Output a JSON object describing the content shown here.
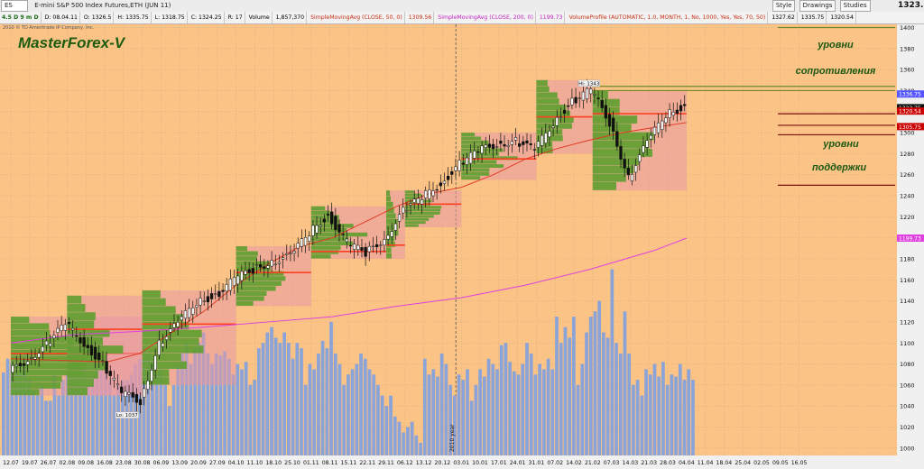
{
  "toolbar": {
    "symbol": "ES",
    "description": "E-mini S&P 500 Index Futures,ETH (JUN 11)",
    "last_price": "1323.75",
    "buttons": [
      {
        "name": "style-button",
        "label": "Style"
      },
      {
        "name": "drawings-button",
        "label": "Drawings"
      },
      {
        "name": "studies-button",
        "label": "Studies"
      }
    ]
  },
  "infobar": {
    "period": "4.5 D 9 m D",
    "date": "D: 08.04.11",
    "open": "O: 1326.5",
    "high": "H: 1335.75",
    "low": "L: 1318.75",
    "close": "C: 1324.25",
    "range": "R: 17",
    "volume_label": "Volume",
    "volume_value": "1,857,370",
    "sma50_label": "SimpleMovingAvg (CLOSE, 50, 0)",
    "sma50_value": "1309.56",
    "sma200_label": "SimpleMovingAvg (CLOSE, 200, 0)",
    "sma200_value": "1199.73",
    "vp_label": "VolumeProfile (AUTOMATIC, 1.0, MONTH, 1, No, 1000, Yes, Yes, 70, 50)",
    "vp_values": [
      "1327.62",
      "1335.75",
      "1320.54"
    ]
  },
  "copyright": "2010 © TD Ameritrade IP Company, Inc.",
  "watermark": "MasterForex-V",
  "annotations": {
    "resistance_1": "уровни",
    "resistance_2": "сопротивления",
    "support_1": "уровни",
    "support_2": "поддержки",
    "hi": "Hi: 1343",
    "lo": "Lo: 1037",
    "year": "2010 year"
  },
  "price_tags": {
    "upper": "1336.75",
    "last": "1323.75",
    "poc": "1320.54",
    "lower": "1305.75",
    "sma200": "1199.73"
  },
  "colors": {
    "background": "#fbc385",
    "volume": "#8aa3d8",
    "profile_green": "#5a9e2c",
    "profile_pink": "#e899a6",
    "sma50": "#e03a24",
    "sma200": "#e040e0",
    "poc": "#ff4020",
    "resistance_line": "#6c8a28",
    "support_line": "#7a1010",
    "annotation_text": "#1e5a14"
  },
  "chart_data": {
    "type": "candlestick",
    "title": "E-mini S&P 500 Index Futures,ETH (JUN 11)",
    "x_axis_labels": [
      "12.07",
      "19.07",
      "26.07",
      "02.08",
      "09.08",
      "16.08",
      "23.08",
      "30.08",
      "06.09",
      "13.09",
      "20.09",
      "27.09",
      "04.10",
      "11.10",
      "18.10",
      "25.10",
      "01.11",
      "08.11",
      "15.11",
      "22.11",
      "29.11",
      "06.12",
      "13.12",
      "20.12",
      "03.01",
      "10.01",
      "17.01",
      "24.01",
      "31.01",
      "07.02",
      "14.02",
      "21.02",
      "07.03",
      "14.03",
      "21.03",
      "28.03",
      "04.04",
      "11.04",
      "18.04",
      "25.04",
      "02.05",
      "09.05",
      "16.05"
    ],
    "y_axis_prices": [
      1000,
      1020,
      1040,
      1060,
      1080,
      1100,
      1120,
      1140,
      1160,
      1180,
      1200,
      1220,
      1240,
      1260,
      1280,
      1300,
      1320,
      1340,
      1360,
      1380,
      1400
    ],
    "ylim": [
      993,
      1403
    ],
    "price_path": [
      {
        "date": "12.07",
        "price": 1072
      },
      {
        "date": "19.07",
        "price": 1085
      },
      {
        "date": "26.07",
        "price": 1098
      },
      {
        "date": "02.08",
        "price": 1118
      },
      {
        "date": "09.08",
        "price": 1100
      },
      {
        "date": "16.08",
        "price": 1080
      },
      {
        "date": "23.08",
        "price": 1052
      },
      {
        "date": "30.08",
        "price": 1045
      },
      {
        "date": "06.09",
        "price": 1100
      },
      {
        "date": "13.09",
        "price": 1118
      },
      {
        "date": "20.09",
        "price": 1140
      },
      {
        "date": "27.09",
        "price": 1145
      },
      {
        "date": "04.10",
        "price": 1160
      },
      {
        "date": "11.10",
        "price": 1170
      },
      {
        "date": "18.10",
        "price": 1178
      },
      {
        "date": "25.10",
        "price": 1182
      },
      {
        "date": "01.11",
        "price": 1205
      },
      {
        "date": "08.11",
        "price": 1222
      },
      {
        "date": "15.11",
        "price": 1195
      },
      {
        "date": "22.11",
        "price": 1185
      },
      {
        "date": "29.11",
        "price": 1200
      },
      {
        "date": "06.12",
        "price": 1225
      },
      {
        "date": "13.12",
        "price": 1238
      },
      {
        "date": "20.12",
        "price": 1252
      },
      {
        "date": "03.01",
        "price": 1270
      },
      {
        "date": "10.01",
        "price": 1282
      },
      {
        "date": "17.01",
        "price": 1290
      },
      {
        "date": "24.01",
        "price": 1292
      },
      {
        "date": "31.01",
        "price": 1283
      },
      {
        "date": "07.02",
        "price": 1310
      },
      {
        "date": "14.02",
        "price": 1330
      },
      {
        "date": "21.02",
        "price": 1340
      },
      {
        "date": "07.03",
        "price": 1310
      },
      {
        "date": "14.03",
        "price": 1258
      },
      {
        "date": "21.03",
        "price": 1290
      },
      {
        "date": "28.03",
        "price": 1318
      },
      {
        "date": "04.04",
        "price": 1325
      }
    ],
    "volume_bars": [
      1072,
      1085,
      1082,
      1070,
      1080,
      1090,
      1065,
      1055,
      1050,
      1060,
      1045,
      1045,
      1070,
      1050,
      1065,
      1070,
      1080,
      1085,
      1070,
      1075,
      1060,
      1068,
      1075,
      1080,
      1070,
      1065,
      1050,
      1060,
      1065,
      1065,
      1070,
      1080,
      1085,
      1095,
      1090,
      1085,
      1070,
      1075,
      1060,
      1040,
      1060,
      1080,
      1090,
      1100,
      1080,
      1095,
      1100,
      1110,
      1090,
      1080,
      1090,
      1088,
      1092,
      1085,
      1070,
      1080,
      1075,
      1082,
      1060,
      1065,
      1095,
      1100,
      1110,
      1115,
      1105,
      1100,
      1110,
      1100,
      1085,
      1100,
      1095,
      1060,
      1080,
      1075,
      1090,
      1102,
      1095,
      1120,
      1090,
      1080,
      1060,
      1070,
      1075,
      1080,
      1090,
      1085,
      1075,
      1070,
      1060,
      1050,
      1040,
      1050,
      1030,
      1025,
      1015,
      1020,
      1025,
      1012,
      1005,
      1085,
      1070,
      1075,
      1068,
      1090,
      1080,
      1060,
      1050,
      1070,
      1065,
      1075,
      1045,
      1060,
      1075,
      1068,
      1085,
      1080,
      1075,
      1098,
      1100,
      1082,
      1073,
      1070,
      1080,
      1100,
      1090,
      1070,
      1080,
      1075,
      1085,
      1075,
      1125,
      1100,
      1115,
      1105,
      1125,
      1060,
      1080,
      1110,
      1125,
      1130,
      1140,
      1110,
      1105,
      1170,
      1100,
      1090,
      1130,
      1090,
      1060,
      1065,
      1050,
      1075,
      1070,
      1080,
      1068,
      1082,
      1060,
      1070,
      1068,
      1080,
      1065,
      1075,
      1065
    ],
    "hi": {
      "label": "Hi: 1343",
      "date": "21.02",
      "price": 1343
    },
    "lo": {
      "label": "Lo: 1037",
      "date": "23.08",
      "price": 1037
    },
    "series": [
      {
        "name": "SimpleMovingAvg (CLOSE, 50, 0)",
        "last": 1309.56,
        "values": [
          [
            0,
            1085
          ],
          [
            6,
            1083
          ],
          [
            9,
            1082
          ],
          [
            12,
            1090
          ],
          [
            15,
            1110
          ],
          [
            18,
            1130
          ],
          [
            21,
            1155
          ],
          [
            24,
            1175
          ],
          [
            27,
            1192
          ],
          [
            30,
            1200
          ],
          [
            33,
            1215
          ],
          [
            36,
            1230
          ],
          [
            39,
            1242
          ],
          [
            42,
            1248
          ],
          [
            45,
            1260
          ],
          [
            48,
            1275
          ],
          [
            51,
            1285
          ],
          [
            54,
            1293
          ],
          [
            57,
            1300
          ],
          [
            60,
            1305
          ],
          [
            63,
            1309.56
          ]
        ]
      },
      {
        "name": "SimpleMovingAvg (CLOSE, 200, 0)",
        "last": 1199.73,
        "values": [
          [
            0,
            1100
          ],
          [
            6,
            1108
          ],
          [
            12,
            1111
          ],
          [
            18,
            1115
          ],
          [
            24,
            1120
          ],
          [
            30,
            1125
          ],
          [
            36,
            1135
          ],
          [
            42,
            1143
          ],
          [
            48,
            1155
          ],
          [
            54,
            1170
          ],
          [
            60,
            1188
          ],
          [
            63,
            1199.73
          ]
        ]
      }
    ],
    "profiles": [
      {
        "val": 1050,
        "vah": 1125,
        "poc": 1090,
        "start": "12.07",
        "end": "30.08"
      },
      {
        "val": 1050,
        "vah": 1145,
        "poc": 1113,
        "start": "02.08",
        "end": "30.08"
      },
      {
        "val": 1060,
        "vah": 1150,
        "poc": 1118,
        "start": "30.08",
        "end": "04.10"
      },
      {
        "val": 1135,
        "vah": 1192,
        "poc": 1167,
        "start": "04.10",
        "end": "01.11"
      },
      {
        "val": 1180,
        "vah": 1230,
        "poc": 1187,
        "start": "01.11",
        "end": "29.11"
      },
      {
        "val": 1180,
        "vah": 1245,
        "poc": 1193,
        "start": "29.11",
        "end": "06.12"
      },
      {
        "val": 1210,
        "vah": 1245,
        "poc": 1232,
        "start": "06.12",
        "end": "03.01"
      },
      {
        "val": 1255,
        "vah": 1300,
        "poc": 1275,
        "start": "03.01",
        "end": "31.01"
      },
      {
        "val": 1280,
        "vah": 1350,
        "poc": 1315,
        "start": "31.01",
        "end": "21.02"
      },
      {
        "val": 1245,
        "vah": 1340,
        "poc": 1318,
        "start": "21.02",
        "end": "04.04"
      }
    ],
    "resistance_levels": [
      1400,
      1344,
      1340
    ],
    "support_levels": [
      1318,
      1307,
      1298,
      1250
    ],
    "grid": true,
    "divider": "03.01"
  }
}
